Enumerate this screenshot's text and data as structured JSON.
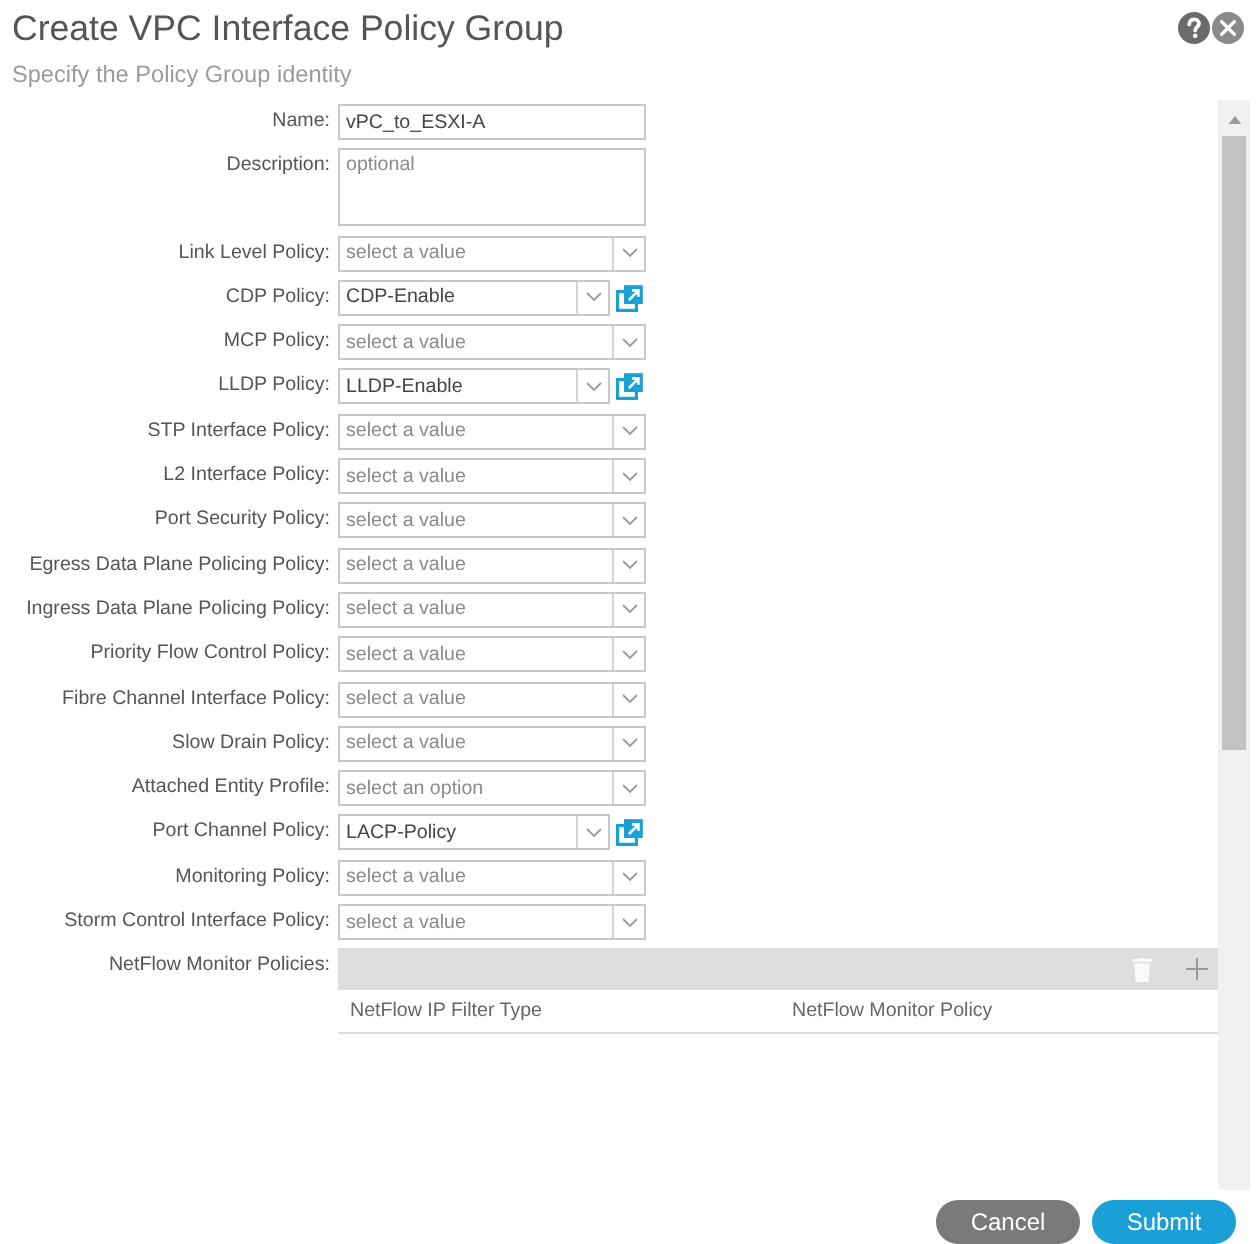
{
  "dialog": {
    "title": "Create VPC Interface Policy Group",
    "subtitle": "Specify the Policy Group identity"
  },
  "fields": [
    {
      "kind": "text",
      "label": "Name:",
      "value": "vPC_to_ESXI-A"
    },
    {
      "kind": "textarea",
      "label": "Description:",
      "placeholder": "optional"
    },
    {
      "kind": "select",
      "label": "Link Level Policy:",
      "placeholder": "select a value",
      "open_button": false
    },
    {
      "kind": "select",
      "label": "CDP Policy:",
      "value": "CDP-Enable",
      "open_button": true
    },
    {
      "kind": "select",
      "label": "MCP Policy:",
      "placeholder": "select a value",
      "open_button": false
    },
    {
      "kind": "select",
      "label": "LLDP Policy:",
      "value": "LLDP-Enable",
      "open_button": true
    },
    {
      "kind": "select",
      "label": "STP Interface Policy:",
      "placeholder": "select a value",
      "open_button": false
    },
    {
      "kind": "select",
      "label": "L2 Interface Policy:",
      "placeholder": "select a value",
      "open_button": false
    },
    {
      "kind": "select",
      "label": "Port Security Policy:",
      "placeholder": "select a value",
      "open_button": false
    },
    {
      "kind": "select",
      "label": "Egress Data Plane Policing Policy:",
      "placeholder": "select a value",
      "open_button": false
    },
    {
      "kind": "select",
      "label": "Ingress Data Plane Policing Policy:",
      "placeholder": "select a value",
      "open_button": false
    },
    {
      "kind": "select",
      "label": "Priority Flow Control Policy:",
      "placeholder": "select a value",
      "open_button": false
    },
    {
      "kind": "select",
      "label": "Fibre Channel Interface Policy:",
      "placeholder": "select a value",
      "open_button": false
    },
    {
      "kind": "select",
      "label": "Slow Drain Policy:",
      "placeholder": "select a value",
      "open_button": false
    },
    {
      "kind": "select",
      "label": "Attached Entity Profile:",
      "placeholder": "select an option",
      "open_button": false
    },
    {
      "kind": "select",
      "label": "Port Channel Policy:",
      "value": "LACP-Policy",
      "open_button": true
    },
    {
      "kind": "select",
      "label": "Monitoring Policy:",
      "placeholder": "select a value",
      "open_button": false
    },
    {
      "kind": "select",
      "label": "Storm Control Interface Policy:",
      "placeholder": "select a value",
      "open_button": false
    }
  ],
  "netflow": {
    "label": "NetFlow Monitor Policies:",
    "columns": [
      "NetFlow IP Filter Type",
      "NetFlow Monitor Policy"
    ]
  },
  "buttons": [
    {
      "kind": "cancel",
      "label": "Cancel"
    },
    {
      "kind": "submit",
      "label": "Submit"
    }
  ]
}
